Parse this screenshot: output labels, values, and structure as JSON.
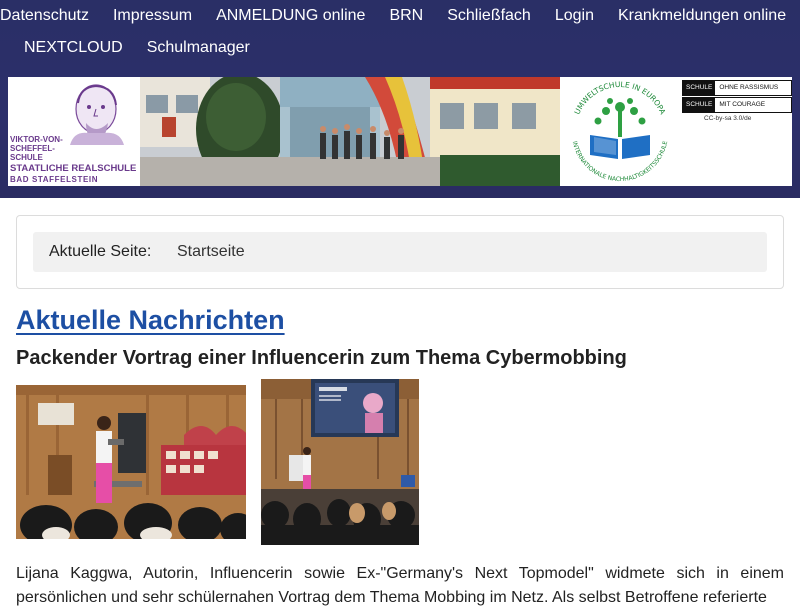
{
  "nav": {
    "items": [
      {
        "label": "Datenschutz"
      },
      {
        "label": "Impressum"
      },
      {
        "label": "ANMELDUNG online"
      },
      {
        "label": "BRN"
      },
      {
        "label": "Schließfach"
      },
      {
        "label": "Login"
      },
      {
        "label": "Krankmeldungen online"
      },
      {
        "label": "NEXTCLOUD"
      },
      {
        "label": "Schulmanager"
      }
    ]
  },
  "banner": {
    "school_name_line1": "VIKTOR-VON-",
    "school_name_line2": "SCHEFFEL-",
    "school_name_line3": "SCHULE",
    "school_type": "STAATLICHE REALSCHULE",
    "school_town": "BAD STAFFELSTEIN",
    "eco_text_top": "UMWELTSCHULE IN EUROPA",
    "eco_text_bottom": "INTERNATIONALE NACHHALTIGKEITSSCHULE",
    "courage_line1_a": "SCHULE",
    "courage_line1_b": "OHNE RASSISMUS",
    "courage_line2_a": "SCHULE",
    "courage_line2_b": "MIT COURAGE",
    "license": "CC-by-sa 3.0/de"
  },
  "breadcrumb": {
    "label": "Aktuelle Seite:",
    "current": "Startseite"
  },
  "main": {
    "section_title": "Aktuelle Nachrichten",
    "article_title": "Packender Vortrag einer Influencerin zum Thema Cybermobbing",
    "article_text": "Lijana Kaggwa, Autorin, Influencerin sowie Ex-\"Germany's Next Topmodel\" widmete sich in einem persönlichen und sehr schülernahen Vortrag dem Thema Mobbing im Netz. Als selbst Betroffene referierte"
  },
  "colors": {
    "header_bg": "#2c2f6b",
    "link": "#1d4fa3"
  }
}
